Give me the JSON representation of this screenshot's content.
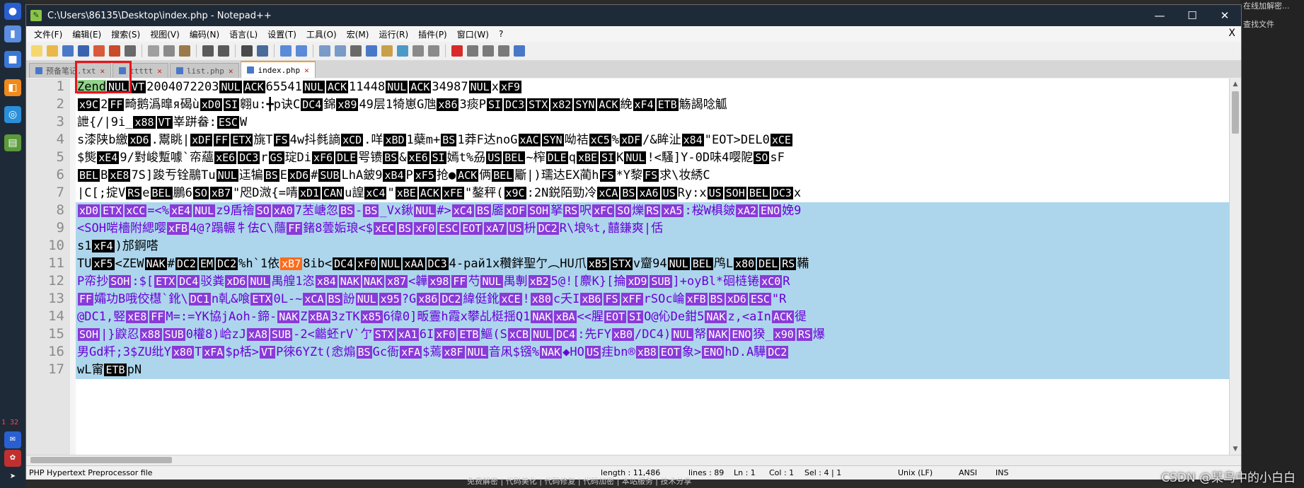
{
  "window": {
    "title": "C:\\Users\\86135\\Desktop\\index.php - Notepad++",
    "controls": {
      "minimize": "—",
      "maximize": "☐",
      "close": "✕"
    }
  },
  "menu": {
    "items": [
      "文件(F)",
      "编辑(E)",
      "搜索(S)",
      "视图(V)",
      "编码(N)",
      "语言(L)",
      "设置(T)",
      "工具(O)",
      "宏(M)",
      "运行(R)",
      "插件(P)",
      "窗口(W)",
      "?"
    ],
    "close": "X"
  },
  "tabs": [
    {
      "label": "预备笔记.txt",
      "active": false
    },
    {
      "label": "ttttt",
      "active": false
    },
    {
      "label": "list.php",
      "active": false
    },
    {
      "label": "index.php",
      "active": true
    }
  ],
  "editor": {
    "line_numbers": [
      "1",
      "2",
      "3",
      "4",
      "5",
      "6",
      "7",
      "8",
      "9",
      "10",
      "11",
      "12",
      "13",
      "14",
      "15",
      "16",
      "17"
    ],
    "lines": [
      "Zend NUL VT 2004072203 NUL ACK 65541 NUL ACK 11448 NUL ACK 34987 NUL x xF9",
      "x9C 2 FF 畸鹅潙曍я碣ù xD0 SI  翱u: ╋p诀C DC4  錦  x89 49层1犄崽G虺 x86 3痰 P SI DC3 STX x82 SYN ACK 絻 xF4 ETB 觞謁唸觚",
      "詍{  /|9i_ x88 VT 峷跰畚: ESC W",
      "s漆陕b繳 xD6 .鬻眺| xDF FF ETX 旐T FS 4w抖毵謪 xCD .咩 xBD 1蘗m+ BS 1莽F达n oG xAC SYN 呦祮 xC5 % xDF /&眸沚 x84 \"EOT>DEL 0 xCE",
      "$熋 xE4 9/對峻蹔噱`帟蘊 xE6 DC3 r GS 琔Di xF6 DLE 咢镄 BS & xE6 SI 嫣t%刕 US BEL ~榨 DLE   q xBE SI K NUL !<騷]Y-0D味4嘤阸 SO sF",
      "BEL B xE8 7S]踆亐铨 鷊Tu NUL 迋  犏 BS E xD6 # SUB LhA鈹9 xB4  P xF5   抢● ACK 俩 BEL 斸|)瓀达EX蔺h  FS *Y黎  FS 求\\妆 綉C",
      "|C[;掟V RS e BEL 鵬6 SO xB7 \"咫D溦{=啨 xD1 CAN u諻 xC4 \" xBE ACK xFE \"鏊秤( x9C :2N鋭陌勁冷 xCA BS xA6 US Ry:x US  SOH BEL DC3 x",
      "xD0 ETX xCC =<% xE4 NUL z9盾禬 SO xA0 7 苤嵣忽 BS - BS _Vx鍬 NUL #> xC4 BS 靥 xDF SOH 拏 RS 呎 xFC SO 爍 RS xA5 :桜W椇皴 xA2   ENO 娩9",
      "  <SOH 啱檣附緦嘤  xFB 4@?蹋輾牜 佉C\\蘟 FF 鍺8蕓姤琅<$ xEC BS xF0 ESC EOT xA7 US   枡 DC2 R\\埌%t,囍鎌爽|佸",
      "s1  xF4 )邡錒嗒",
      "TU  xF5 <ZEW NAK # DC2 EM DC2 %h  `1依 xB7 8ib< DC4 xF0 NUL xAA DC3 4-рай1x穳鉡聖亇︵HU爪 xB5 STX v齏94 NUL BEL 鸤L x80 DEL RS 鞴",
      "P帟抄 SOH :$[ ETX DC4 驳粪 xD6 NUL 禺艎1恣 x84 NAK NAK x87 <韡 x98 FF 芍 NUL 禺剸 xB2 5@![麖  K}[掄 xD9 SUB ]+oyBl*硘梿锩  xC0 R",
      "FF 孀功B哦佼櫘`鈋\\ DC1 n乹&喰 ETX 0L-~ xCA BS 訜 NUL x95 ?G x86 DC2 緯侹鈋   xCE ! x80 c夭I xB6 FS xFF rS Oc崘 xFB    BS xD6 ESC \"R",
      "@DC1  ,竪 xE8 FF M=:=YK協jAoh-鍗- NAK Z xBA 3zTK x85 6徫0]畈霻h霞x攀乩梃揺Q1 NAK xBA <<腥 EOT SI O@伈De鉗5 NAK z,<aIn ACK 徥",
      "SOH |}鼵忍 x88 SUB 0權8)峆zJ xA8 SUB -2<龤蚽rV`亇 STX xA1 6I xF0 ETB 鰸(S xCB NUL DC4 :先FY xB0 /DC4) NUL 帑 NAK ENO 猤_ x90 RS 爆",
      "男Gd粁;3$ZU纰Y x80 T xFA $p栝> VT P徠6YZt(悆煽 BS Gc衙 xFA $蔫 x8F NUL 音凩$镪% NAK ◆H    O US 疰bn® xB8 EOT 象> ENO hD.A驊 DC2",
      "wL甯 ETB pN"
    ]
  },
  "status": {
    "file_type": "PHP Hypertext Preprocessor file",
    "length": "length : 11,486",
    "lines": "lines : 89",
    "ln": "Ln : 1",
    "col": "Col : 1",
    "sel": "Sel : 4 | 1",
    "eol": "Unix (LF)",
    "encoding": "ANSI",
    "mode": "INS"
  },
  "desktop": {
    "right_items": [
      "在线加解密...",
      "查找文件"
    ],
    "badge": "1 32",
    "watermark": "CSDN @某鸟中的小白白",
    "bottom_links": "免费解密 | 代码美化 | 代码修复 | 代码加密 | 本站服务 | 技术分享"
  },
  "colors": {
    "control_char_bg": "#000000",
    "extended_char_bg": "#8a3ad8",
    "selection_bg": "#add6ec",
    "string_color": "#8000ff",
    "annotation_box": "#e8141c",
    "titlebar": "#1f2a38"
  }
}
